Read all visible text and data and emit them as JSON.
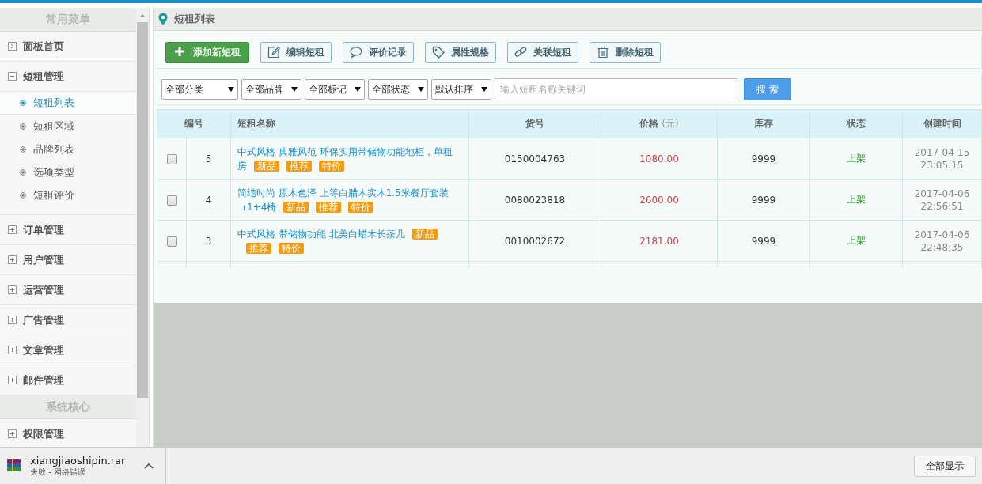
{
  "sidebar": {
    "sections": [
      {
        "title": "常用菜单",
        "items": [
          {
            "label": "面板首页",
            "kind": "link"
          },
          {
            "label": "短租管理",
            "kind": "group",
            "expanded": true,
            "children": [
              {
                "label": "短租列表",
                "selected": true
              },
              {
                "label": "短租区域",
                "selected": false
              },
              {
                "label": "品牌列表",
                "selected": false
              },
              {
                "label": "选项类型",
                "selected": false
              },
              {
                "label": "短租评价",
                "selected": false
              }
            ]
          },
          {
            "label": "订单管理",
            "kind": "group",
            "expanded": false
          },
          {
            "label": "用户管理",
            "kind": "group",
            "expanded": false
          },
          {
            "label": "运营管理",
            "kind": "group",
            "expanded": false
          },
          {
            "label": "广告管理",
            "kind": "group",
            "expanded": false
          },
          {
            "label": "文章管理",
            "kind": "group",
            "expanded": false
          },
          {
            "label": "邮件管理",
            "kind": "group",
            "expanded": false
          }
        ]
      },
      {
        "title": "系统核心",
        "items": [
          {
            "label": "权限管理",
            "kind": "group",
            "expanded": false
          }
        ]
      }
    ]
  },
  "page": {
    "title": "短租列表"
  },
  "toolbar": [
    {
      "label": "添加新短租",
      "kind": "primary"
    },
    {
      "label": "编辑短租",
      "kind": "default"
    },
    {
      "label": "评价记录",
      "kind": "default"
    },
    {
      "label": "属性规格",
      "kind": "default"
    },
    {
      "label": "关联短租",
      "kind": "default"
    },
    {
      "label": "删除短租",
      "kind": "default"
    }
  ],
  "filters": [
    {
      "value": "全部分类"
    },
    {
      "value": "全部品牌"
    },
    {
      "value": "全部标记"
    },
    {
      "value": "全部状态"
    },
    {
      "value": "默认排序"
    }
  ],
  "search": {
    "placeholder": "输入短租名称关键词",
    "button": "搜 索"
  },
  "table": {
    "columns": [
      {
        "label": "编号"
      },
      {
        "label": "短租名称"
      },
      {
        "label": "货号"
      },
      {
        "label": "价格",
        "unit": "(元)"
      },
      {
        "label": "库存"
      },
      {
        "label": "状态"
      },
      {
        "label": "创建时间"
      }
    ],
    "rows": [
      {
        "checked": false,
        "id": "5",
        "name_lines": [
          {
            "text": "中式风格 典雅风范 环保实用带储物功能地柜，单租"
          },
          {
            "text": "房",
            "tags": [
              "新品",
              "推荐",
              "特价"
            ]
          }
        ],
        "sku": "0150004763",
        "price": "1080.00",
        "stock": "9999",
        "status": "上架",
        "on_sale": true,
        "created": [
          "2017-04-15",
          "23:05:15"
        ]
      },
      {
        "checked": false,
        "id": "4",
        "name_lines": [
          {
            "text": "简结时尚 原木色泽 上等白腊木实木1.5米餐厅套装"
          },
          {
            "text": "（1+4椅",
            "tags": [
              "新品",
              "推荐",
              "特价"
            ]
          }
        ],
        "sku": "0080023818",
        "price": "2600.00",
        "stock": "9999",
        "status": "上架",
        "on_sale": true,
        "created": [
          "2017-04-06",
          "22:56:51"
        ]
      },
      {
        "checked": false,
        "id": "3",
        "name_lines": [
          {
            "text": "中式风格 带储物功能 北美白蜡木长茶几",
            "tags": [
              "新品"
            ]
          },
          {
            "tags": [
              "推荐",
              "特价"
            ]
          }
        ],
        "sku": "0010002672",
        "price": "2181.00",
        "stock": "9999",
        "status": "上架",
        "on_sale": true,
        "created": [
          "2017-04-06",
          "22:48:35"
        ]
      }
    ]
  },
  "download_bar": {
    "file": "xiangjiaoshipin.rar",
    "status": "失败 - 网络错误",
    "show_all": "全部显示"
  }
}
